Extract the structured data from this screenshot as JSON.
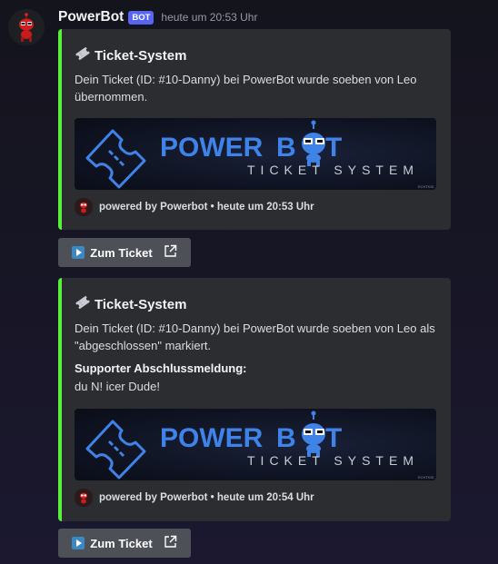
{
  "message": {
    "username": "PowerBot",
    "bot_tag": "BOT",
    "timestamp": "heute um 20:53 Uhr"
  },
  "embeds": [
    {
      "title": "Ticket-System",
      "description": "Dein Ticket (ID: #10-Danny) bei PowerBot wurde soeben von Leo übernommen.",
      "banner": {
        "word1": "POWER",
        "word2": "B",
        "word3": "T",
        "subtitle": "TICKET SYSTEM",
        "signature": "ECHTKID"
      },
      "footer": "powered by Powerbot • heute um 20:53 Uhr",
      "button": "Zum Ticket"
    },
    {
      "title": "Ticket-System",
      "description": "Dein Ticket (ID: #10-Danny) bei PowerBot wurde soeben von Leo als \"abgeschlossen\" markiert.",
      "field_name": "Supporter Abschlussmeldung:",
      "field_value": "du N! icer Dude!",
      "banner": {
        "word1": "POWER",
        "word2": "B",
        "word3": "T",
        "subtitle": "TICKET SYSTEM",
        "signature": "ECHTKID"
      },
      "footer": "powered by Powerbot • heute um 20:54 Uhr",
      "button": "Zum Ticket"
    }
  ],
  "colors": {
    "embed_accent": "#57f03a",
    "bot_tag": "#5865f2",
    "brand_blue": "#3f82e8"
  },
  "icons": [
    "bot-avatar",
    "ticket-icon",
    "play-icon",
    "external-link-icon"
  ]
}
